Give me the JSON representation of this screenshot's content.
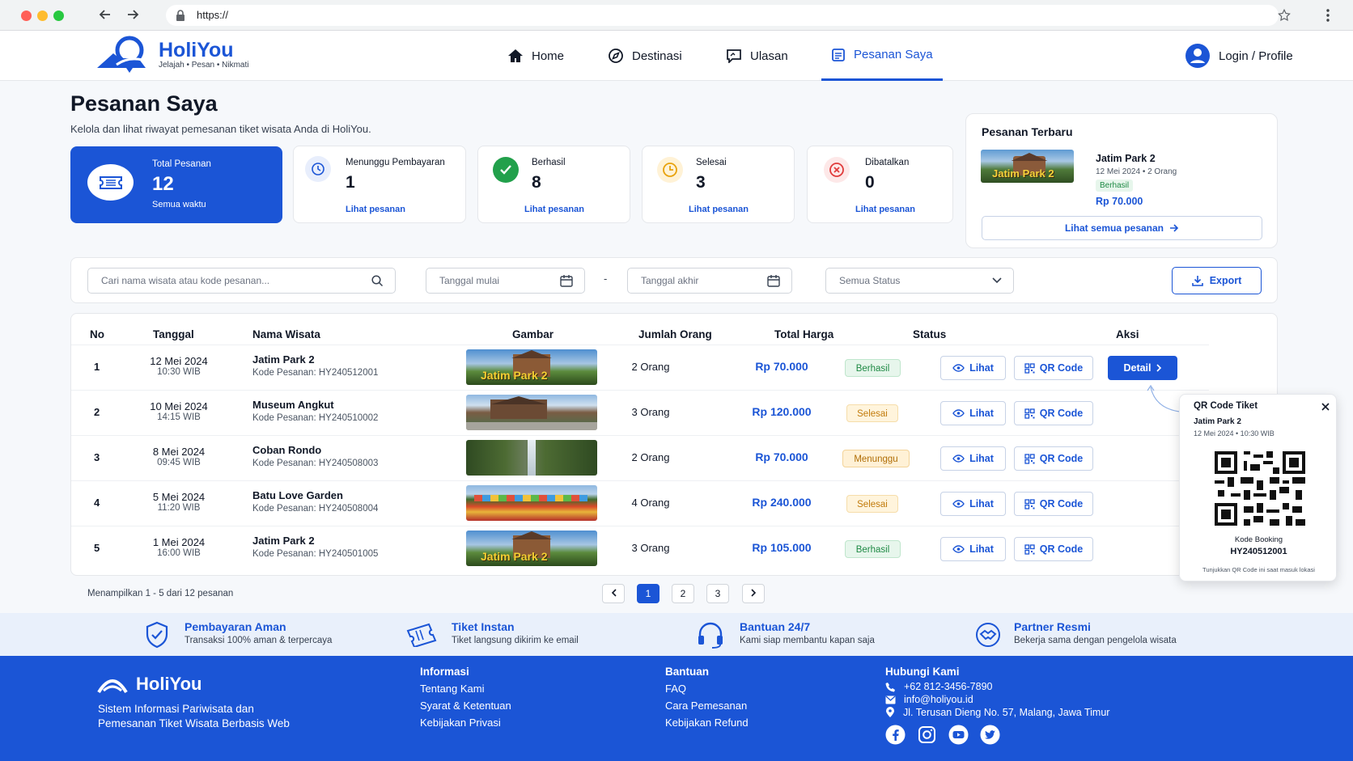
{
  "browser": {
    "url": "https://"
  },
  "brand": {
    "name": "HoliYou",
    "tagline": "Jelajah • Pesan • Nikmati"
  },
  "nav": {
    "items": [
      {
        "label": "Home"
      },
      {
        "label": "Destinasi"
      },
      {
        "label": "Ulasan"
      },
      {
        "label": "Pesanan Saya"
      }
    ],
    "login": "Login / Profile"
  },
  "page": {
    "title": "Pesanan Saya",
    "subtitle": "Kelola dan lihat riwayat pemesanan tiket wisata Anda di HoliYou."
  },
  "stats": {
    "total": {
      "label": "Total Pesanan",
      "value": "12",
      "note": "Semua waktu"
    },
    "cards": [
      {
        "label": "Menunggu Pembayaran",
        "value": "1",
        "link": "Lihat pesanan"
      },
      {
        "label": "Berhasil",
        "value": "8",
        "link": "Lihat pesanan"
      },
      {
        "label": "Selesai",
        "value": "3",
        "link": "Lihat pesanan"
      },
      {
        "label": "Dibatalkan",
        "value": "0",
        "link": "Lihat pesanan"
      }
    ]
  },
  "latest": {
    "heading": "Pesanan Terbaru",
    "name": "Jatim Park 2",
    "meta": "12 Mei 2024 • 2 Orang",
    "status": "Berhasil",
    "price": "Rp 70.000",
    "all_link": "Lihat semua pesanan"
  },
  "filters": {
    "search_placeholder": "Cari nama wisata atau kode pesanan...",
    "start": "Tanggal mulai",
    "dash": "-",
    "end": "Tanggal akhir",
    "status": "Semua Status",
    "export": "Export"
  },
  "table": {
    "headers": [
      "No",
      "Tanggal",
      "Nama Wisata",
      "Gambar",
      "Jumlah Orang",
      "Total Harga",
      "Status",
      "Aksi"
    ],
    "rows": [
      {
        "no": "1",
        "date": "12 Mei 2024",
        "time": "10:30 WIB",
        "name": "Jatim Park 2",
        "code": "Kode Pesanan: HY240512001",
        "people": "2 Orang",
        "price": "Rp 70.000",
        "status": "Berhasil"
      },
      {
        "no": "2",
        "date": "10 Mei 2024",
        "time": "14:15 WIB",
        "name": "Museum Angkut",
        "code": "Kode Pesanan: HY240510002",
        "people": "3 Orang",
        "price": "Rp 120.000",
        "status": "Selesai"
      },
      {
        "no": "3",
        "date": "8 Mei 2024",
        "time": "09:45 WIB",
        "name": "Coban Rondo",
        "code": "Kode Pesanan: HY240508003",
        "people": "2 Orang",
        "price": "Rp 70.000",
        "status": "Menunggu"
      },
      {
        "no": "4",
        "date": "5 Mei 2024",
        "time": "11:20 WIB",
        "name": "Batu Love Garden",
        "code": "Kode Pesanan: HY240508004",
        "people": "4 Orang",
        "price": "Rp 240.000",
        "status": "Selesai"
      },
      {
        "no": "5",
        "date": "1 Mei 2024",
        "time": "16:00 WIB",
        "name": "Jatim Park 2",
        "code": "Kode Pesanan: HY240501005",
        "people": "3 Orang",
        "price": "Rp 105.000",
        "status": "Berhasil"
      }
    ],
    "actions": {
      "view": "Lihat",
      "qr": "QR Code",
      "detail": "Detail"
    },
    "thumb_text": "Jatim Park 2"
  },
  "qr_popup": {
    "title": "QR Code Tiket",
    "name": "Jatim Park 2",
    "meta": "12 Mei 2024 • 10:30 WIB",
    "code_label": "Kode Booking",
    "code": "HY240512001",
    "hint": "Tunjukkan QR Code ini saat masuk lokasi"
  },
  "pagination": {
    "summary": "Menampilkan 1 - 5 dari 12 pesanan",
    "pages": [
      "1",
      "2",
      "3"
    ],
    "current": "1"
  },
  "features": [
    {
      "title": "Pembayaran Aman",
      "text": "Transaksi 100% aman & terpercaya"
    },
    {
      "title": "Tiket Instan",
      "text": "Tiket langsung dikirim ke email"
    },
    {
      "title": "Bantuan 24/7",
      "text": "Kami siap membantu kapan saja"
    },
    {
      "title": "Partner Resmi",
      "text": "Bekerja sama dengan pengelola wisata"
    }
  ],
  "footer": {
    "brand": "HoliYou",
    "desc1": "Sistem Informasi Pariwisata dan",
    "desc2": "Pemesanan Tiket Wisata Berbasis Web",
    "info_title": "Informasi",
    "info": [
      "Tentang Kami",
      "Syarat & Ketentuan",
      "Kebijakan Privasi"
    ],
    "help_title": "Bantuan",
    "help": [
      "FAQ",
      "Cara Pemesanan",
      "Kebijakan Refund"
    ],
    "contact_title": "Hubungi Kami",
    "phone": "+62 812-3456-7890",
    "email": "info@holiyou.id",
    "address": "Jl. Terusan Dieng No. 57, Malang, Jawa Timur"
  },
  "colors": {
    "primary": "#1b55d6",
    "success": "#1f8a45",
    "warning": "#c27b0b",
    "danger": "#e03b3b"
  }
}
